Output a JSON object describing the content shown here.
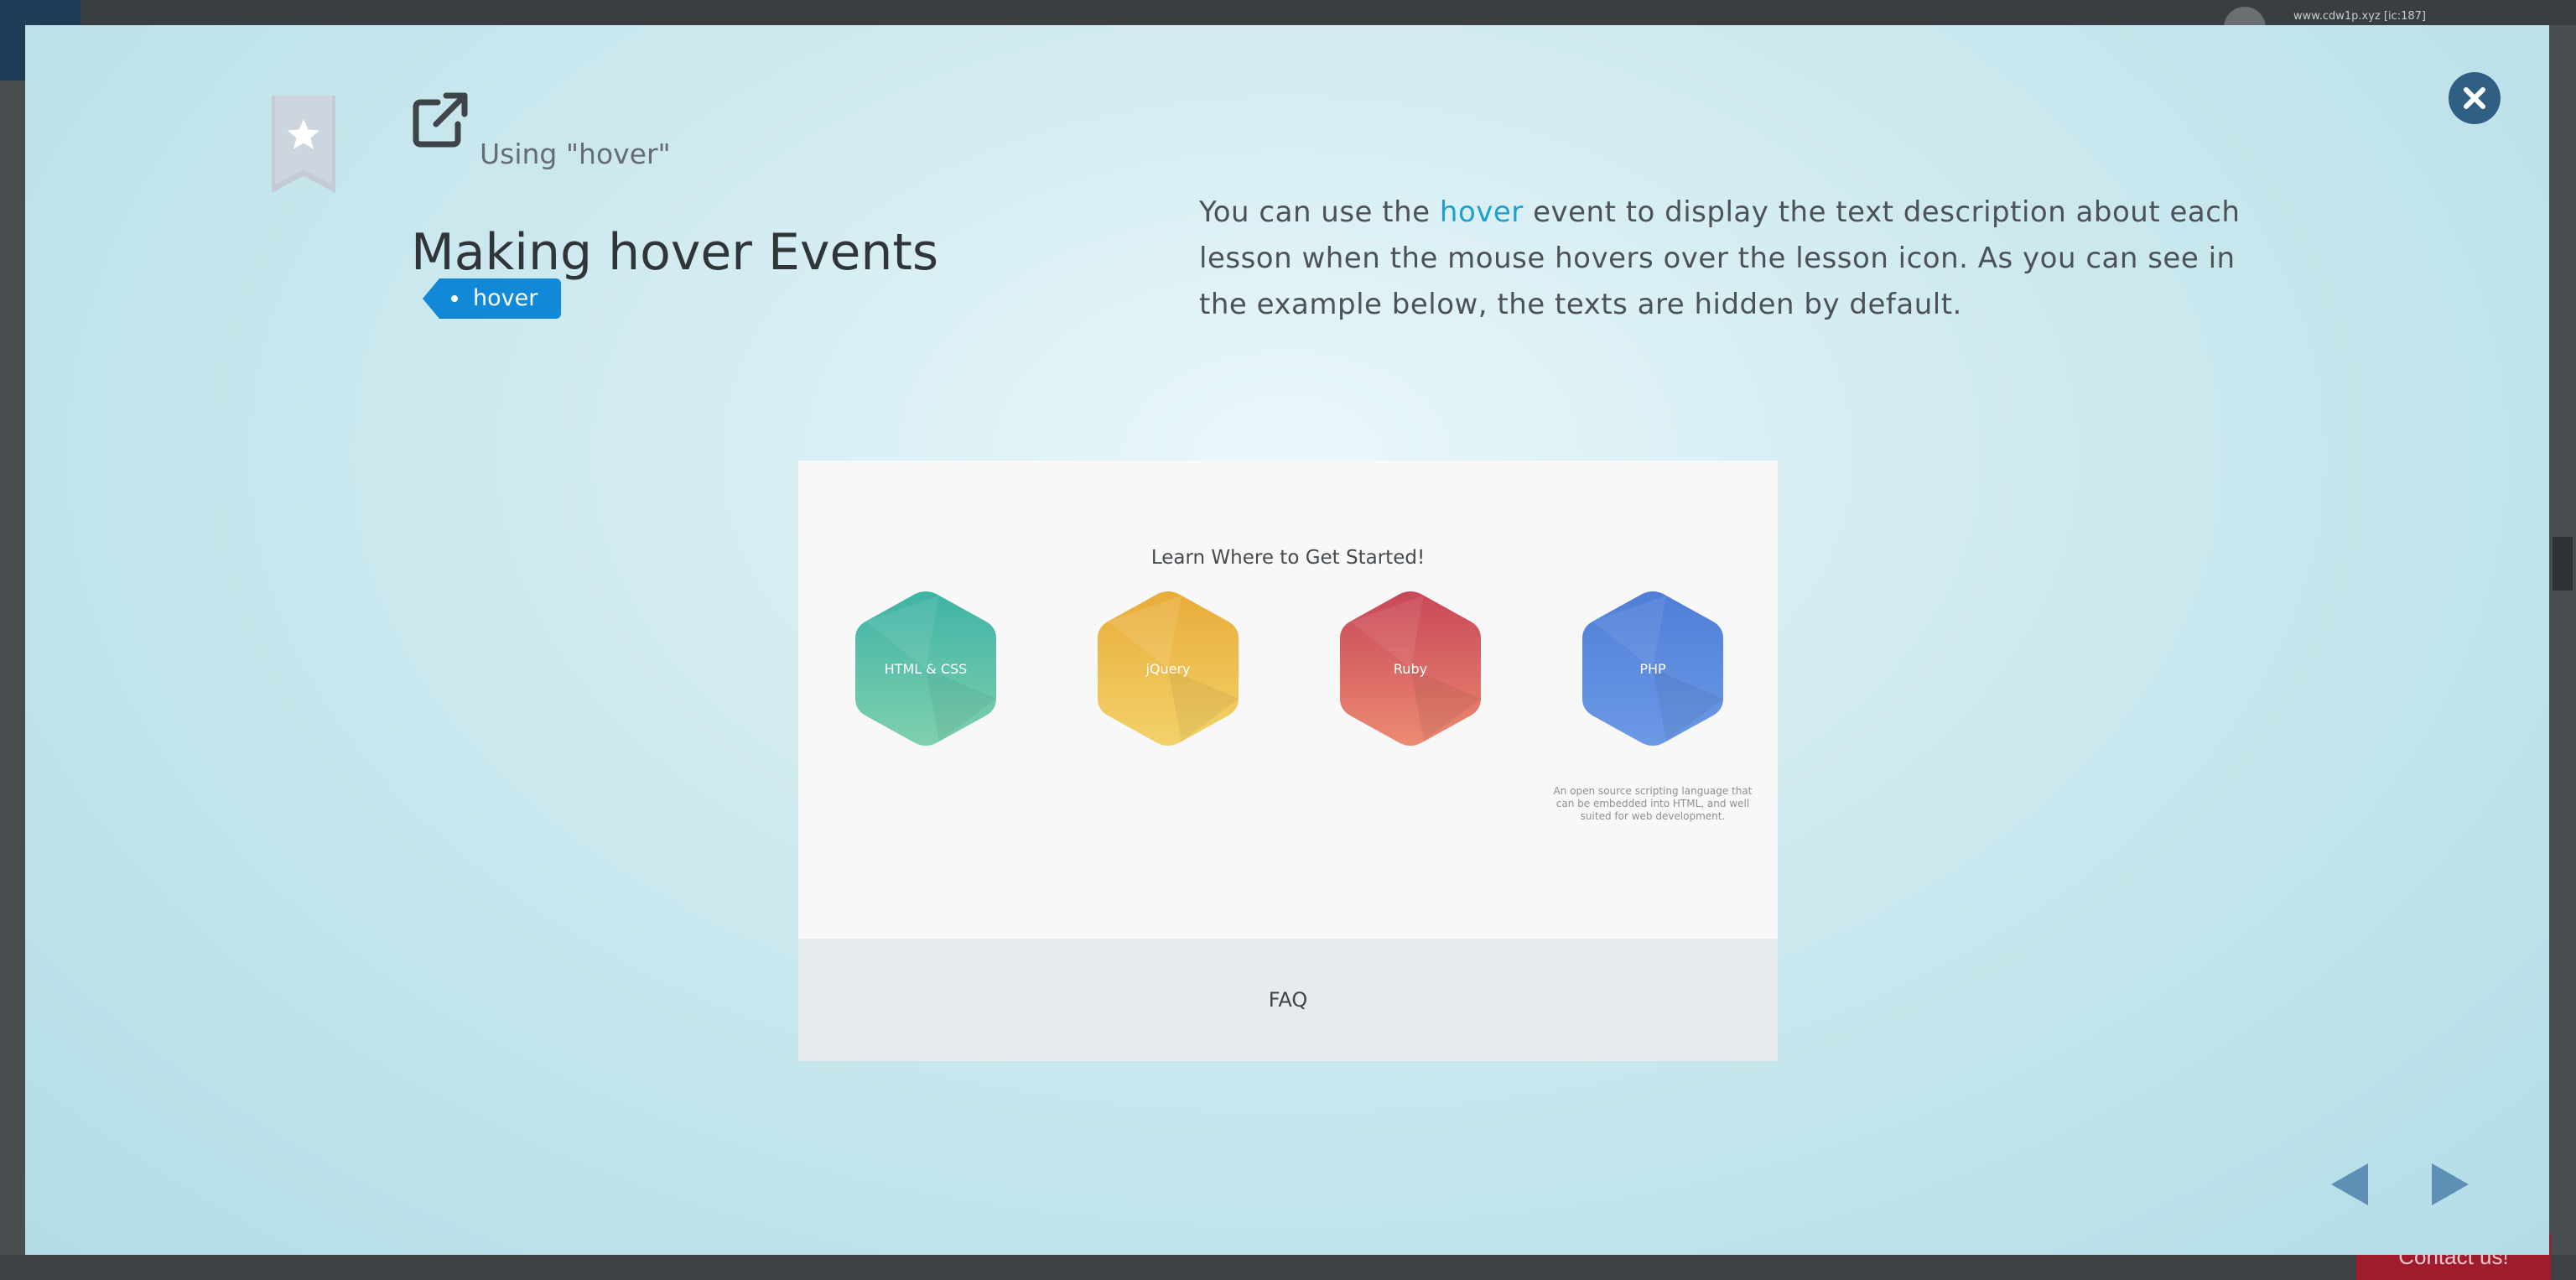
{
  "background": {
    "url_text": "www.cdw1p.xyz [ic:187]",
    "contact_label": "Contact us!"
  },
  "header": {
    "subtitle": "Using \"hover\"",
    "title": "Making hover Events",
    "tag": "hover"
  },
  "description": {
    "before": "You can use the ",
    "highlight": "hover",
    "after": " event to display the text description about each lesson when the mouse hovers over the lesson icon. As you can see in the example below, the texts are hidden by default."
  },
  "example": {
    "heading": "Learn Where to Get Started!",
    "items": [
      {
        "label": "HTML & CSS",
        "color_top": "#3fb3a6",
        "color_bottom": "#7fd0ae"
      },
      {
        "label": "jQuery",
        "color_top": "#e8ac3a",
        "color_bottom": "#f3d26a"
      },
      {
        "label": "Ruby",
        "color_top": "#c94758",
        "color_bottom": "#ec8a72"
      },
      {
        "label": "PHP",
        "color_top": "#4f7ed8",
        "color_bottom": "#6c9ae6"
      }
    ],
    "hover_description": "An open source scripting language that can be embedded into HTML, and well suited for web development.",
    "footer": "FAQ"
  },
  "colors": {
    "accent": "#1e9fd3",
    "tag_bg": "#1288d8",
    "close_bg": "#2f5f82",
    "arrow": "#5e90b5"
  },
  "icons": {
    "close": "close-icon",
    "bookmark": "bookmark-star-icon",
    "external": "external-link-icon",
    "prev": "arrow-left-icon",
    "next": "arrow-right-icon"
  }
}
